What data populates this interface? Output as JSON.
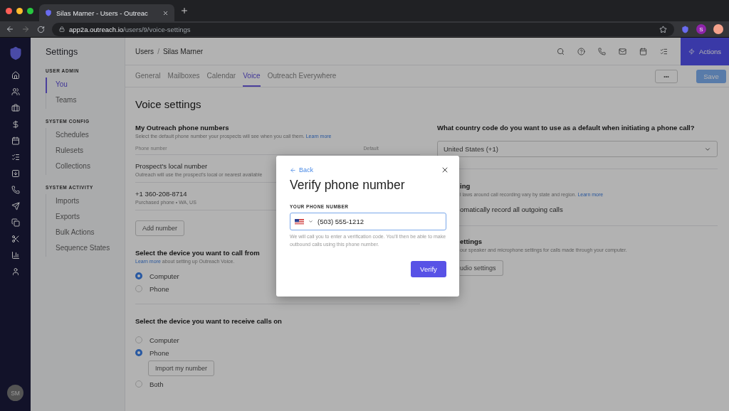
{
  "browser": {
    "tab_title": "Silas Marner - Users - Outreac",
    "url_host": "app2a.outreach.io",
    "url_path": "/users/9/voice-settings",
    "profile": "S"
  },
  "rail": {
    "avatar": "SM"
  },
  "sidebar": {
    "title": "Settings",
    "sections": [
      {
        "heading": "USER ADMIN",
        "items": [
          {
            "label": "You",
            "selected": true
          },
          {
            "label": "Teams",
            "selected": false
          }
        ]
      },
      {
        "heading": "SYSTEM CONFIG",
        "items": [
          {
            "label": "Schedules",
            "selected": false
          },
          {
            "label": "Rulesets",
            "selected": false
          },
          {
            "label": "Collections",
            "selected": false
          }
        ]
      },
      {
        "heading": "SYSTEM ACTIVITY",
        "items": [
          {
            "label": "Imports",
            "selected": false
          },
          {
            "label": "Exports",
            "selected": false
          },
          {
            "label": "Bulk Actions",
            "selected": false
          },
          {
            "label": "Sequence States",
            "selected": false
          }
        ]
      }
    ]
  },
  "header": {
    "breadcrumb": [
      "Users",
      "Silas Marner"
    ],
    "separator": "/",
    "actions_button": "Actions"
  },
  "tabs": [
    {
      "label": "General",
      "selected": false
    },
    {
      "label": "Mailboxes",
      "selected": false
    },
    {
      "label": "Calendar",
      "selected": false
    },
    {
      "label": "Voice",
      "selected": true
    },
    {
      "label": "Outreach Everywhere",
      "selected": false
    }
  ],
  "toolbar": {
    "more_button": "•••",
    "save_button": "Save"
  },
  "content": {
    "title": "Voice settings",
    "phone_numbers": {
      "heading": "My Outreach phone numbers",
      "description": "Select the default phone number your prospects will see when you call them.",
      "link": "Learn more",
      "column_1": "Phone number",
      "column_2": "Default",
      "rows": [
        {
          "name": "Prospect's local number",
          "detail": "Outreach will use the prospect's local or nearest available"
        },
        {
          "name": "+1 360-208-8714",
          "detail": "Purchased phone • WA, US"
        }
      ],
      "add_button": "Add number"
    },
    "call_from": {
      "heading": "Select the device you want to call from",
      "link": "Learn more",
      "description": "about setting up Outreach Voice.",
      "options": [
        {
          "label": "Computer",
          "selected": true
        },
        {
          "label": "Phone",
          "selected": false
        }
      ]
    },
    "receive_on": {
      "heading": "Select the device you want to receive calls on",
      "options": [
        {
          "label": "Computer",
          "selected": false
        },
        {
          "label": "Phone",
          "selected": true,
          "button": "Import my number"
        },
        {
          "label": "Both",
          "selected": false
        }
      ]
    },
    "country": {
      "question": "What country code do you want to use as a default when initiating a phone call?",
      "value": "United States (+1)"
    },
    "recording": {
      "heading": "ing",
      "description": "l laws around call recording vary by state and region.",
      "link": "Learn more",
      "toggle_label": "omatically record all outgoing calls"
    },
    "audio": {
      "heading": "ettings",
      "description": "our speaker and microphone settings for calls made through your computer.",
      "button": "udio settings"
    }
  },
  "modal": {
    "back": "Back",
    "title": "Verify phone number",
    "field_label": "YOUR PHONE NUMBER",
    "value": "(503) 555-1212",
    "hint": "We will call you to enter a verification code. You'll then be able to make outbound calls using this phone number.",
    "button": "Verify"
  }
}
